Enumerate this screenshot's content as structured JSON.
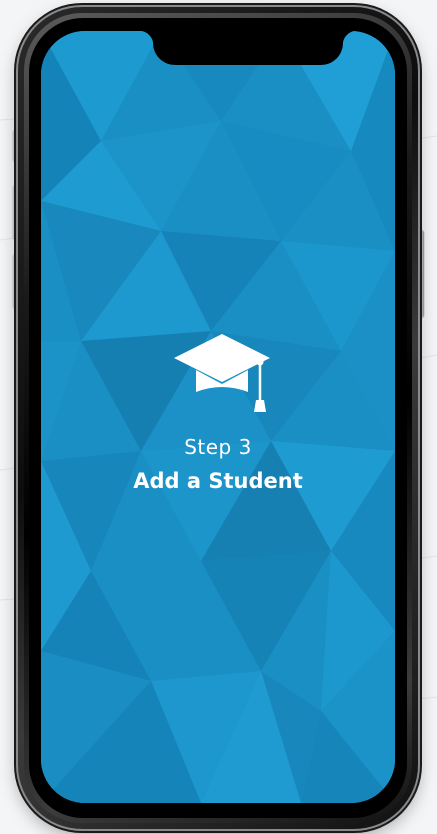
{
  "onboarding": {
    "step_label": "Step 3",
    "step_title": "Add a Student",
    "icon": "graduation-cap-icon"
  },
  "colors": {
    "screen_background": "#1a8fc4",
    "text": "#ffffff",
    "device_frame": "#111111"
  }
}
